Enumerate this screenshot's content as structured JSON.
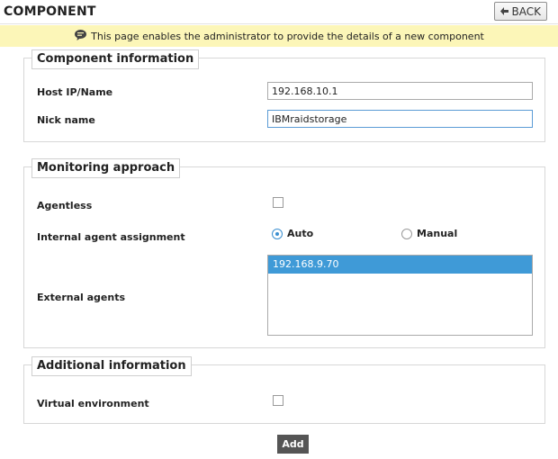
{
  "header": {
    "title": "COMPONENT",
    "back_label": "BACK",
    "back_icon": "back-arrow-icon"
  },
  "notice": {
    "icon": "info-bubble-icon",
    "text": "This page enables the administrator to provide the details of a new component"
  },
  "component_information": {
    "legend": "Component information",
    "host_label": "Host IP/Name",
    "host_value": "192.168.10.1",
    "nick_label": "Nick name",
    "nick_value": "IBMraidstorage"
  },
  "monitoring_approach": {
    "legend": "Monitoring approach",
    "agentless_label": "Agentless",
    "agentless_checked": false,
    "internal_label": "Internal agent assignment",
    "internal_options": [
      {
        "label": "Auto",
        "selected": true
      },
      {
        "label": "Manual",
        "selected": false
      }
    ],
    "external_label": "External agents",
    "external_agents": [
      "192.168.9.70"
    ]
  },
  "additional_information": {
    "legend": "Additional information",
    "virtual_label": "Virtual environment",
    "virtual_checked": false
  },
  "actions": {
    "add_label": "Add"
  },
  "colors": {
    "notice_bg": "#fcf6b8",
    "selection": "#3f9ad7",
    "add_button": "#555555"
  }
}
